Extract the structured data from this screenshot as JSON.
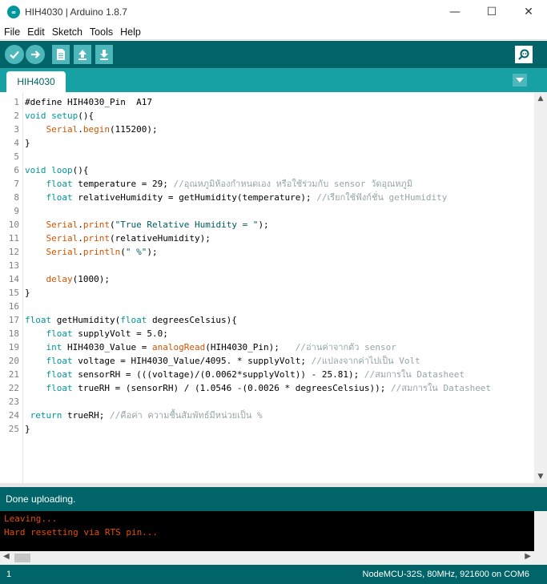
{
  "window": {
    "title": "HIH4030 | Arduino 1.8.7",
    "minimize_glyph": "—",
    "maximize_glyph": "☐",
    "close_glyph": "✕"
  },
  "menu": [
    "File",
    "Edit",
    "Sketch",
    "Tools",
    "Help"
  ],
  "toolbar": {
    "buttons": [
      "verify-icon",
      "upload-icon",
      "new-icon",
      "open-icon",
      "save-icon"
    ],
    "serial_monitor": "serial-monitor-icon"
  },
  "tabs": [
    {
      "label": "HIH4030"
    }
  ],
  "editor": {
    "lines": [
      [
        {
          "t": "#define HIH4030_Pin  A17"
        }
      ],
      [
        {
          "t": "void",
          "c": "kw"
        },
        {
          "t": " "
        },
        {
          "t": "setup",
          "c": "kw"
        },
        {
          "t": "(){"
        }
      ],
      [
        {
          "t": "    "
        },
        {
          "t": "Serial",
          "c": "fn"
        },
        {
          "t": "."
        },
        {
          "t": "begin",
          "c": "fn"
        },
        {
          "t": "(115200);"
        }
      ],
      [
        {
          "t": "}"
        }
      ],
      [
        {
          "t": ""
        }
      ],
      [
        {
          "t": "void",
          "c": "kw"
        },
        {
          "t": " "
        },
        {
          "t": "loop",
          "c": "kw"
        },
        {
          "t": "(){"
        }
      ],
      [
        {
          "t": "    "
        },
        {
          "t": "float",
          "c": "kw"
        },
        {
          "t": " temperature = 29; "
        },
        {
          "t": "//อุณหภูมิห้องกำหนดเอง หรือใช้ร่วมกับ sensor วัดอุณหภูมิ",
          "c": "cmt"
        }
      ],
      [
        {
          "t": "    "
        },
        {
          "t": "float",
          "c": "kw"
        },
        {
          "t": " relativeHumidity = getHumidity(temperature); "
        },
        {
          "t": "//เรียกใช้ฟังก์ชั่น getHumidity",
          "c": "cmt"
        }
      ],
      [
        {
          "t": ""
        }
      ],
      [
        {
          "t": "    "
        },
        {
          "t": "Serial",
          "c": "fn"
        },
        {
          "t": "."
        },
        {
          "t": "print",
          "c": "fn"
        },
        {
          "t": "("
        },
        {
          "t": "\"True Relative Humidity = \"",
          "c": "str"
        },
        {
          "t": ");"
        }
      ],
      [
        {
          "t": "    "
        },
        {
          "t": "Serial",
          "c": "fn"
        },
        {
          "t": "."
        },
        {
          "t": "print",
          "c": "fn"
        },
        {
          "t": "(relativeHumidity);"
        }
      ],
      [
        {
          "t": "    "
        },
        {
          "t": "Serial",
          "c": "fn"
        },
        {
          "t": "."
        },
        {
          "t": "println",
          "c": "fn"
        },
        {
          "t": "("
        },
        {
          "t": "\" %\"",
          "c": "str"
        },
        {
          "t": ");"
        }
      ],
      [
        {
          "t": ""
        }
      ],
      [
        {
          "t": "    "
        },
        {
          "t": "delay",
          "c": "fn"
        },
        {
          "t": "(1000);"
        }
      ],
      [
        {
          "t": "}"
        }
      ],
      [
        {
          "t": ""
        }
      ],
      [
        {
          "t": "float",
          "c": "kw"
        },
        {
          "t": " getHumidity("
        },
        {
          "t": "float",
          "c": "kw"
        },
        {
          "t": " degreesCelsius){"
        }
      ],
      [
        {
          "t": "    "
        },
        {
          "t": "float",
          "c": "kw"
        },
        {
          "t": " supplyVolt = 5.0;"
        }
      ],
      [
        {
          "t": "    "
        },
        {
          "t": "int",
          "c": "kw"
        },
        {
          "t": " HIH4030_Value = "
        },
        {
          "t": "analogRead",
          "c": "fn"
        },
        {
          "t": "(HIH4030_Pin);   "
        },
        {
          "t": "//อ่านค่าจากตัว sensor",
          "c": "cmt"
        }
      ],
      [
        {
          "t": "    "
        },
        {
          "t": "float",
          "c": "kw"
        },
        {
          "t": " voltage = HIH4030_Value/4095. * supplyVolt; "
        },
        {
          "t": "//แปลงจากค่าไปเป็น Volt",
          "c": "cmt"
        }
      ],
      [
        {
          "t": "    "
        },
        {
          "t": "float",
          "c": "kw"
        },
        {
          "t": " sensorRH = (((voltage)/(0.0062*supplyVolt)) - 25.81); "
        },
        {
          "t": "//สมการใน Datasheet",
          "c": "cmt"
        }
      ],
      [
        {
          "t": "    "
        },
        {
          "t": "float",
          "c": "kw"
        },
        {
          "t": " trueRH = (sensorRH) / (1.0546 -(0.0026 * degreesCelsius)); "
        },
        {
          "t": "//สมการใน Datasheet",
          "c": "cmt"
        }
      ],
      [
        {
          "t": ""
        }
      ],
      [
        {
          "t": " "
        },
        {
          "t": "return",
          "c": "kw"
        },
        {
          "t": " trueRH; "
        },
        {
          "t": "//คือค่า ความชื้นสัมพัทธ์มีหน่วยเป็น %",
          "c": "cmt"
        }
      ],
      [
        {
          "t": "}"
        }
      ]
    ]
  },
  "status": {
    "message": "Done uploading."
  },
  "console": {
    "lines": [
      "Leaving...",
      "Hard resetting via RTS pin..."
    ]
  },
  "footer": {
    "line_number": "1",
    "board": "NodeMCU-32S, 80MHz, 921600 on COM6"
  },
  "colors": {
    "toolbar": "#006468",
    "tabbar": "#17a1a5",
    "button": "#4db7bb",
    "keyword": "#00979c",
    "function": "#d35400",
    "comment": "#95a5a6",
    "console_text": "#e34c00"
  }
}
